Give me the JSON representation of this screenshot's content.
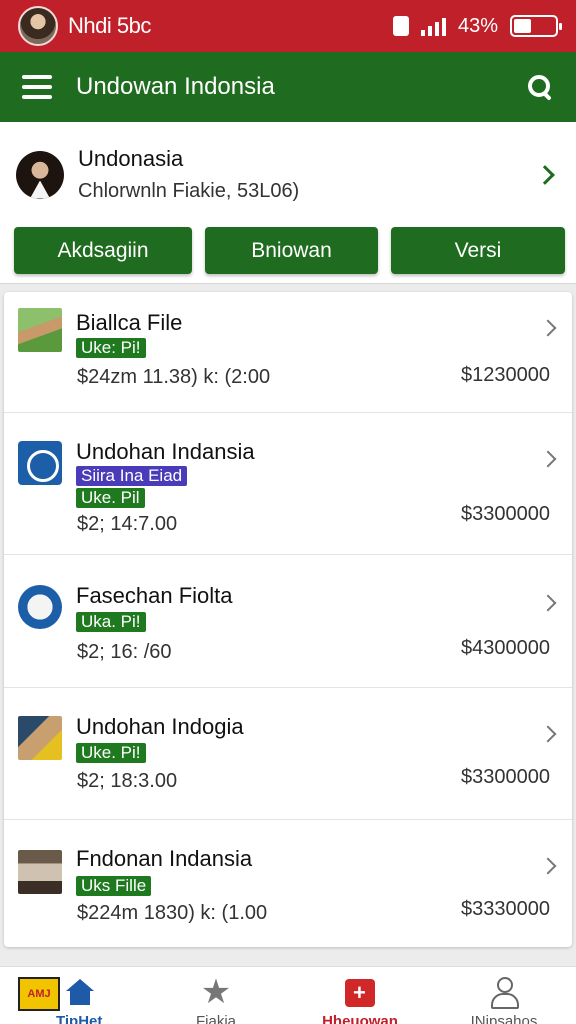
{
  "status_bar": {
    "name": "Nhdi 5bc",
    "battery_pct": "43%",
    "battery_level": 0.43,
    "icons": [
      "avatar",
      "sim-icon",
      "signal-icon",
      "battery-icon"
    ]
  },
  "app_bar": {
    "title": "Undowan Indonsia",
    "icons": [
      "menu-icon",
      "search-icon"
    ]
  },
  "profile": {
    "name": "Undonasia",
    "subtitle": "Chlorwnln Fiakie, 53L06)",
    "buttons": [
      "Akdsagiin",
      "Bniowan",
      "Versi"
    ]
  },
  "list": {
    "items": [
      {
        "title": "Biallca File",
        "tags": [
          {
            "text": "Uke: Pi!",
            "color": "#1f7a1f"
          }
        ],
        "date": "$24zm 11.38) k: (2:00",
        "price": "$1230000",
        "thumb": "photo-thumb"
      },
      {
        "title": "Undohan Indansia",
        "tags": [
          {
            "text": "Siira Ina Eiad",
            "color": "#4a3bb8"
          },
          {
            "text": "Uke. Pil",
            "color": "#1f7a1f"
          }
        ],
        "date": "$2; 14:7.00",
        "price": "$3300000",
        "thumb": "badge-thumb"
      },
      {
        "title": "Fasechan Fiolta",
        "tags": [
          {
            "text": "Uka. Pi!",
            "color": "#1f7a1f"
          }
        ],
        "date": "$2; 16: /60",
        "price": "$4300000",
        "thumb": "round-thumb"
      },
      {
        "title": "Undohan Indogia",
        "tags": [
          {
            "text": "Uke. Pi!",
            "color": "#1f7a1f"
          }
        ],
        "date": "$2; 18:3.00",
        "price": "$3300000",
        "thumb": "photo-thumb"
      },
      {
        "title": "Fndonan Indansia",
        "tags": [
          {
            "text": "Uks Fille",
            "color": "#1f7a1f"
          }
        ],
        "date": "$224m 1830) k: (1.00",
        "price": "$3330000",
        "thumb": "photo-thumb"
      }
    ]
  },
  "bottom_nav": {
    "logo_text": "AMJ",
    "items": [
      {
        "label": "TipHet",
        "icon": "home-icon",
        "active": true
      },
      {
        "label": "Fiakia",
        "icon": "star-icon",
        "active": false
      },
      {
        "label": "Hheuowan",
        "icon": "bag-icon",
        "active": false
      },
      {
        "label": "INipsahos",
        "icon": "user-icon",
        "active": false
      }
    ]
  },
  "colors": {
    "status_red": "#c0202a",
    "primary_green": "#1f6b1f",
    "tag_purple": "#4a3bb8",
    "nav_blue": "#1e5aa8"
  }
}
